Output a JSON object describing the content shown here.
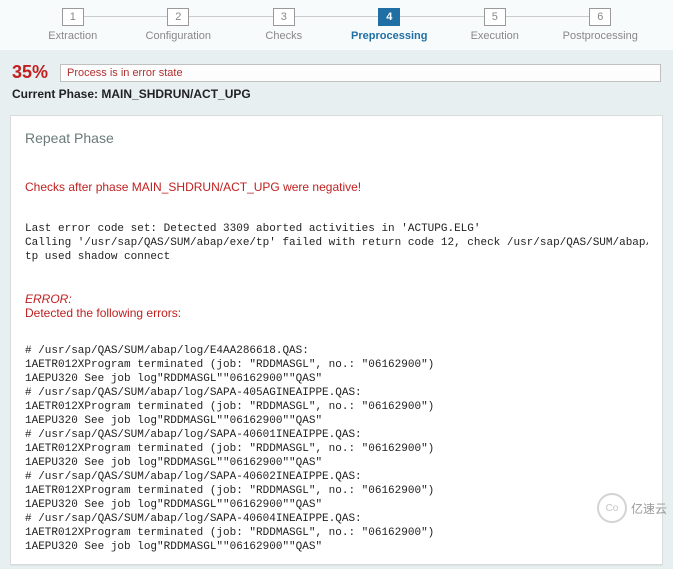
{
  "steps": [
    {
      "num": "1",
      "label": "Extraction"
    },
    {
      "num": "2",
      "label": "Configuration"
    },
    {
      "num": "3",
      "label": "Checks"
    },
    {
      "num": "4",
      "label": "Preprocessing"
    },
    {
      "num": "5",
      "label": "Execution"
    },
    {
      "num": "6",
      "label": "Postprocessing"
    }
  ],
  "progress": {
    "percent": "35%",
    "message": "Process is in error state"
  },
  "phase": {
    "label": "Current Phase: ",
    "name": "MAIN_SHDRUN/ACT_UPG"
  },
  "repeat_label": "Repeat Phase",
  "neg_title": "Checks after phase MAIN_SHDRUN/ACT_UPG were negative!",
  "pre_lines": [
    "Last error code set: Detected 3309 aborted activities in 'ACTUPG.ELG'",
    "Calling '/usr/sap/QAS/SUM/abap/exe/tp' failed with return code 12, check /usr/sap/QAS/SUM/abap/log/SAPu",
    "tp used shadow connect"
  ],
  "error_header": "ERROR:",
  "error_sub": "Detected the following errors:",
  "err_lines": [
    "# /usr/sap/QAS/SUM/abap/log/E4AA286618.QAS:",
    "1AETR012XProgram terminated (job: \"RDDMASGL\", no.: \"06162900\")",
    "1AEPU320 See job log\"RDDMASGL\"\"06162900\"\"QAS\"",
    "# /usr/sap/QAS/SUM/abap/log/SAPA-405AGINEAIPPE.QAS:",
    "1AETR012XProgram terminated (job: \"RDDMASGL\", no.: \"06162900\")",
    "1AEPU320 See job log\"RDDMASGL\"\"06162900\"\"QAS\"",
    "# /usr/sap/QAS/SUM/abap/log/SAPA-40601INEAIPPE.QAS:",
    "1AETR012XProgram terminated (job: \"RDDMASGL\", no.: \"06162900\")",
    "1AEPU320 See job log\"RDDMASGL\"\"06162900\"\"QAS\"",
    "# /usr/sap/QAS/SUM/abap/log/SAPA-40602INEAIPPE.QAS:",
    "1AETR012XProgram terminated (job: \"RDDMASGL\", no.: \"06162900\")",
    "1AEPU320 See job log\"RDDMASGL\"\"06162900\"\"QAS\"",
    "# /usr/sap/QAS/SUM/abap/log/SAPA-40604INEAIPPE.QAS:",
    "1AETR012XProgram terminated (job: \"RDDMASGL\", no.: \"06162900\")",
    "1AEPU320 See job log\"RDDMASGL\"\"06162900\"\"QAS\""
  ],
  "watermark": {
    "glyph": "Co",
    "text": "亿速云"
  }
}
